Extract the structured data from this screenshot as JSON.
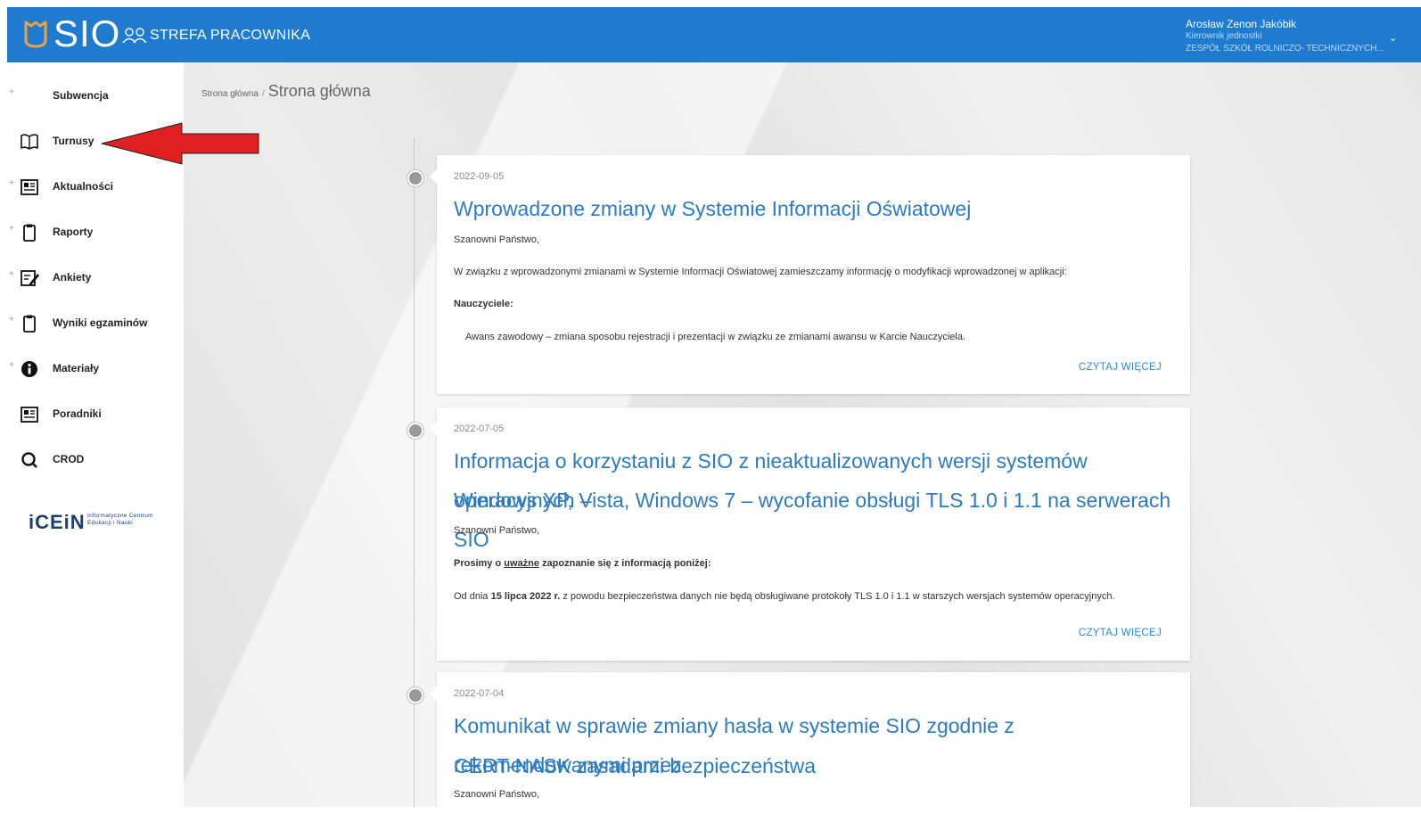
{
  "header": {
    "logo_text": "SIO",
    "subtitle": "STREFA PRACOWNIKA",
    "user": {
      "name": "Arosław Zenon Jakóbik",
      "role": "Kierownik jednostki",
      "organization": "ZESPÓŁ SZKÓŁ ROLNICZO- TECHNICZNYCH..."
    },
    "brand_color": "#1e7bd0",
    "logo_accent_color": "#e8a444"
  },
  "sidebar": {
    "items": [
      {
        "label": "Subwencja",
        "icon": "none",
        "expandable": true
      },
      {
        "label": "Turnusy",
        "icon": "book-open-icon",
        "expandable": false
      },
      {
        "label": "Aktualności",
        "icon": "newspaper-icon",
        "expandable": true
      },
      {
        "label": "Raporty",
        "icon": "clipboard-icon",
        "expandable": true
      },
      {
        "label": "Ankiety",
        "icon": "edit-form-icon",
        "expandable": true
      },
      {
        "label": "Wyniki egzaminów",
        "icon": "clipboard-icon",
        "expandable": true
      },
      {
        "label": "Materiały",
        "icon": "info-circle-icon",
        "expandable": true
      },
      {
        "label": "Poradniki",
        "icon": "newspaper-icon",
        "expandable": false
      },
      {
        "label": "CROD",
        "icon": "search-icon",
        "expandable": false
      }
    ],
    "expand_symbol": "+",
    "footer_logo": {
      "text": "iCEiN",
      "subtitle_line1": "Informatyczne Centrum",
      "subtitle_line2": "Edukacji i Nauki"
    }
  },
  "annotation": {
    "arrow_color": "#e02020",
    "points_to": "Turnusy"
  },
  "breadcrumb": {
    "parent": "Strona główna",
    "separator": "/",
    "current": "Strona główna"
  },
  "news": [
    {
      "date": "2022-09-05",
      "title": "Wprowadzone zmiany w Systemie Informacji Oświatowej",
      "greeting": "Szanowni Państwo,",
      "line1": "W związku z wprowadzonymi zmianami w Systemie Informacji Oświatowej zamieszczamy informację o modyfikacji wprowadzonej w aplikacji:",
      "heading": "Nauczyciele:",
      "line2": "Awans zawodowy – zmiana sposobu rejestracji i prezentacji w związku ze zmianami awansu w Karcie Nauczyciela.",
      "read_more": "CZYTAJ WIĘCEJ"
    },
    {
      "date": "2022-07-05",
      "title_line1": "Informacja o korzystaniu z SIO z nieaktualizowanych wersji systemów operacyjnych –",
      "title_line2": "Windows XP, Vista, Windows 7 – wycofanie obsługi TLS 1.0 i 1.1 na serwerach SIO",
      "greeting": "Szanowni Państwo,",
      "request_prefix": "Prosimy o ",
      "request_emphasis": "uważne",
      "request_suffix": " zapoznanie się z informacją poniżej:",
      "notice_prefix": "Od dnia ",
      "notice_date": "15 lipca 2022 r.",
      "notice_suffix": " z powodu bezpieczeństwa danych nie będą obsługiwane protokoły TLS 1.0 i 1.1 w starszych wersjach systemów operacyjnych.",
      "read_more": "CZYTAJ WIĘCEJ"
    },
    {
      "date": "2022-07-04",
      "title_line1": "Komunikat w sprawie zmiany hasła w systemie SIO zgodnie z rekomendowanymi przez",
      "title_line2": "CERT-NASK zasadami bezpieczeństwa",
      "greeting": "Szanowni Państwo,"
    }
  ]
}
